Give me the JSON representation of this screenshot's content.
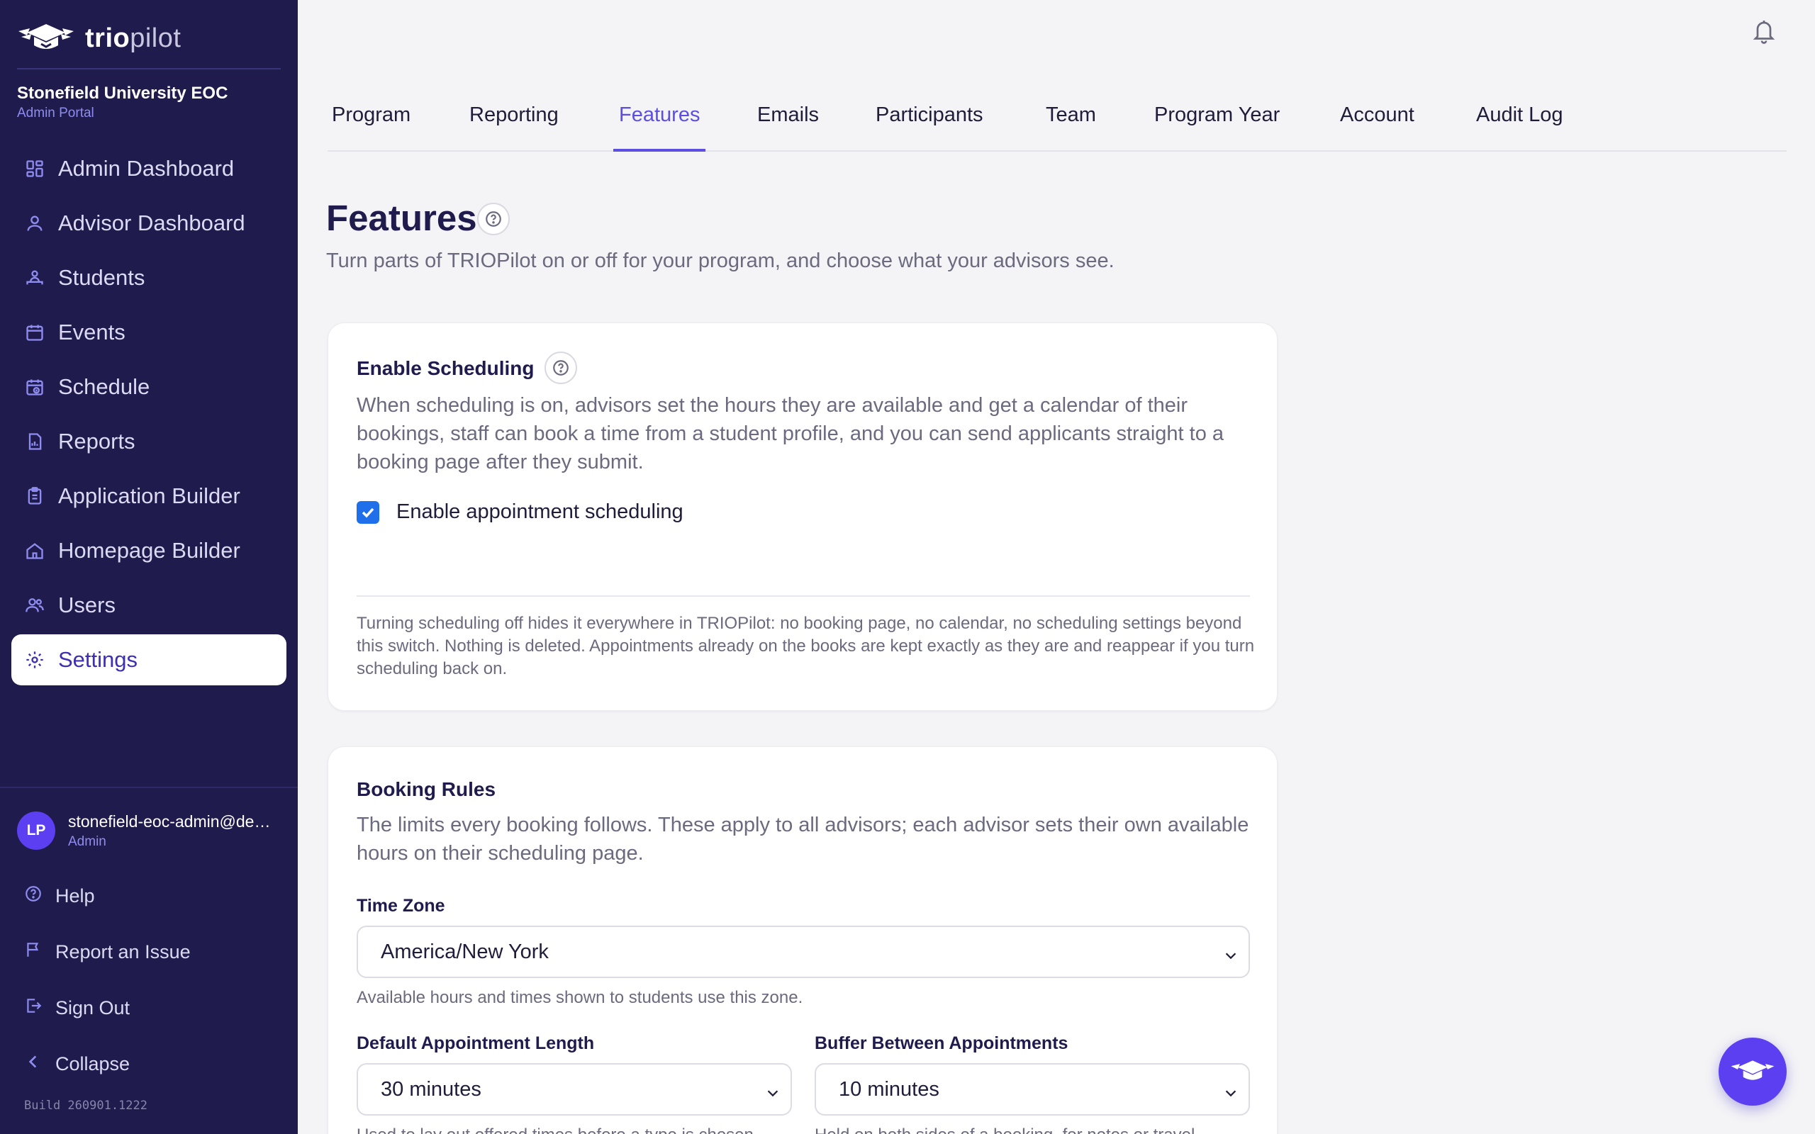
{
  "brand": {
    "name_bold": "trio",
    "name_light": "pilot"
  },
  "org": {
    "name": "Stonefield University EOC",
    "portal": "Admin Portal"
  },
  "nav": [
    {
      "label": "Admin Dashboard",
      "icon": "dashboard-icon"
    },
    {
      "label": "Advisor Dashboard",
      "icon": "user-icon"
    },
    {
      "label": "Students",
      "icon": "students-icon"
    },
    {
      "label": "Events",
      "icon": "calendar-icon"
    },
    {
      "label": "Schedule",
      "icon": "schedule-icon"
    },
    {
      "label": "Reports",
      "icon": "report-icon"
    },
    {
      "label": "Application Builder",
      "icon": "clipboard-icon"
    },
    {
      "label": "Homepage Builder",
      "icon": "home-icon"
    },
    {
      "label": "Users",
      "icon": "users-icon"
    },
    {
      "label": "Settings",
      "icon": "gear-icon",
      "active": true
    }
  ],
  "user": {
    "initials": "LP",
    "email": "stonefield-eoc-admin@demo.triopilot.com",
    "role": "Admin"
  },
  "footer_links": {
    "help": "Help",
    "report": "Report an Issue",
    "signout": "Sign Out",
    "collapse": "Collapse"
  },
  "build": "Build 260901.1222",
  "tabs": [
    "Program",
    "Reporting",
    "Features",
    "Emails",
    "Participants",
    "Team",
    "Program Year",
    "Account",
    "Audit Log"
  ],
  "active_tab": "Features",
  "page": {
    "title": "Features",
    "subtitle": "Turn parts of TRIOPilot on or off for your program, and choose what your advisors see."
  },
  "scheduling": {
    "title": "Enable Scheduling",
    "description": "When scheduling is on, advisors set the hours they are available and get a calendar of their bookings, staff can book a time from a student profile, and you can send applicants straight to a booking page after they submit.",
    "checkbox_label": "Enable appointment scheduling",
    "checked": true,
    "note": "Turning scheduling off hides it everywhere in TRIOPilot: no booking page, no calendar, no scheduling settings beyond this switch. Nothing is deleted. Appointments already on the books are kept exactly as they are and reappear if you turn scheduling back on."
  },
  "booking": {
    "title": "Booking Rules",
    "description": "The limits every booking follows. These apply to all advisors; each advisor sets their own available hours on their scheduling page.",
    "timezone_label": "Time Zone",
    "timezone_value": "America/New York",
    "timezone_hint": "Available hours and times shown to students use this zone.",
    "length_label": "Default Appointment Length",
    "length_value": "30 minutes",
    "length_hint": "Used to lay out offered times before a type is chosen.",
    "buffer_label": "Buffer Between Appointments",
    "buffer_value": "10 minutes",
    "buffer_hint": "Held on both sides of a booking, for notes or travel."
  },
  "colors": {
    "sidebar": "#1f1b4d",
    "accent": "#5b4ee0",
    "checkbox": "#1f6feb"
  }
}
